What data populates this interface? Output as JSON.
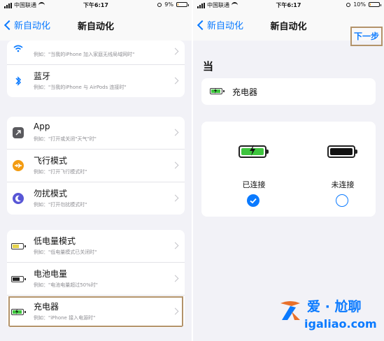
{
  "status_left": {
    "carrier": "中国联通",
    "time": "下午6:17",
    "battery": "9%",
    "battery_level": 0.09
  },
  "status_right": {
    "carrier": "中国联通",
    "time": "下午6:17",
    "battery": "10%",
    "battery_level": 0.1
  },
  "left": {
    "back_label": "新自动化",
    "title": "新自动化",
    "groups": [
      {
        "rows": [
          {
            "title": "",
            "sub": "例如：\"当我的iPhone 加入家庭无线局域网时\"",
            "icon": "wifi-icon"
          },
          {
            "title": "蓝牙",
            "sub": "例如：\"当我的iPhone 与 AirPods 连接时\"",
            "icon": "bluetooth-icon"
          }
        ]
      },
      {
        "rows": [
          {
            "title": "App",
            "sub": "例如：\"打开或关闭\"天气\"时\"",
            "icon": "app-icon"
          },
          {
            "title": "飞行模式",
            "sub": "例如：\"打开飞行模式时\"",
            "icon": "airplane-icon"
          },
          {
            "title": "勿扰模式",
            "sub": "例如：\"打开勿扰模式时\"",
            "icon": "moon-icon"
          }
        ]
      },
      {
        "rows": [
          {
            "title": "低电量模式",
            "sub": "例如：\"低电量模式已关闭时\"",
            "icon": "low-power-battery-icon"
          },
          {
            "title": "电池电量",
            "sub": "例如：\"电池电量超过50%时\"",
            "icon": "battery-icon"
          },
          {
            "title": "充电器",
            "sub": "例如：\"iPhone 接入电源时\"",
            "icon": "charger-icon",
            "selected": true
          }
        ]
      }
    ]
  },
  "right": {
    "back_label": "新自动化",
    "title": "新自动化",
    "next_label": "下一步",
    "when_label": "当",
    "charger_label": "充电器",
    "options": [
      {
        "label": "已连接",
        "selected": true,
        "icon": "charging-battery-icon"
      },
      {
        "label": "未连接",
        "selected": false,
        "icon": "full-battery-icon"
      }
    ]
  },
  "watermark": {
    "brand": "爱 · 尬聊",
    "site": "igaliao.com"
  },
  "colors": {
    "accent": "#0a7aff",
    "highlight_border": "#b3936a",
    "charging_green": "#3ec43e",
    "low_power_yellow": "#e5d34a",
    "background": "#f2f2f7"
  }
}
